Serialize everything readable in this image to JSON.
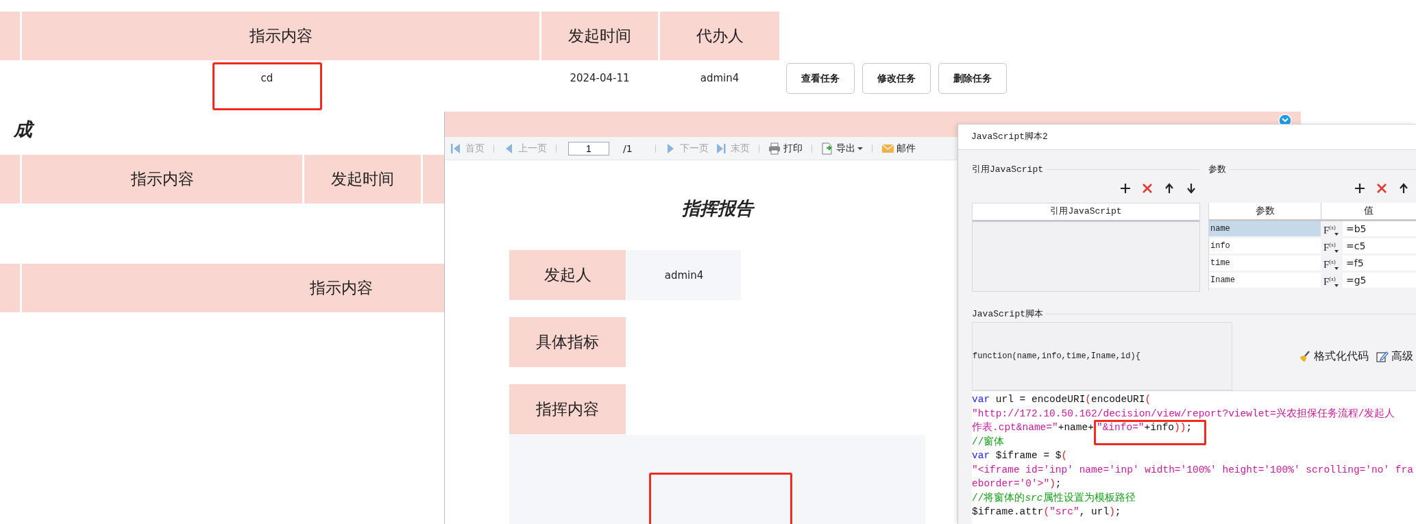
{
  "pending_tasks": {
    "columns": [
      "指示内容",
      "发起时间",
      "代办人"
    ],
    "rows": [
      {
        "cells": [
          {
            "text": "cd",
            "highlighted": true
          },
          {
            "text": "2024-04-11",
            "highlighted": false
          },
          {
            "text": "admin4",
            "highlighted": false
          }
        ],
        "actions": [
          "查看任务",
          "修改任务",
          "删除任务"
        ]
      }
    ]
  },
  "completed_section": {
    "heading": "成",
    "columns": [
      "指示内容",
      "发起时间"
    ]
  },
  "third_table": {
    "columns": [
      "指示内容"
    ]
  },
  "report_viewer": {
    "toolbar": [
      {
        "kind": "first",
        "label": "首页",
        "disabled": true
      },
      {
        "kind": "prev",
        "label": "上一页",
        "disabled": true
      },
      {
        "kind": "page-input",
        "value": "1"
      },
      {
        "kind": "page-total",
        "label": "/1"
      },
      {
        "kind": "next",
        "label": "下一页",
        "disabled": true
      },
      {
        "kind": "last",
        "label": "末页",
        "disabled": true
      },
      {
        "kind": "print",
        "label": "打印",
        "disabled": false
      },
      {
        "kind": "export",
        "label": "导出",
        "disabled": false
      },
      {
        "kind": "mail",
        "label": "邮件",
        "disabled": false
      }
    ],
    "title": "指挥报告",
    "fields": [
      {
        "label": "发起人",
        "value": "admin4"
      },
      {
        "label": "具体指标"
      },
      {
        "label": "指挥内容"
      }
    ],
    "content_area": {
      "highlighted": true
    }
  },
  "js_dialog": {
    "title": "JavaScript脚本2",
    "imported_js": {
      "label": "引用JavaScript",
      "column": "引用JavaScript"
    },
    "params": {
      "label": "参数",
      "columns": [
        "参数",
        "值"
      ],
      "rows": [
        {
          "name": "name",
          "formula": "F$^{(x)}$",
          "value": "=b5",
          "selected": true
        },
        {
          "name": "info",
          "formula": "F$^{(x)}$",
          "value": "=c5",
          "selected": false
        },
        {
          "name": "time",
          "formula": "F$^{(x)}$",
          "value": "=f5",
          "selected": false
        },
        {
          "name": "Iname",
          "formula": "F$^{(x)}$",
          "value": "=g5",
          "selected": false
        }
      ]
    },
    "script": {
      "label": "JavaScript脚本",
      "signature": "function(name,info,time,Iname,id){",
      "actions": [
        {
          "kind": "format",
          "label": "格式化代码"
        },
        {
          "kind": "advanced",
          "label": "高级"
        }
      ],
      "code_lines": [
        {
          "tokens": [
            {
              "kind": "keyword",
              "text": "var"
            },
            {
              "kind": "plain",
              "text": " url = encodeURI"
            },
            {
              "kind": "paren",
              "text": "("
            },
            {
              "kind": "plain",
              "text": "encodeURI"
            },
            {
              "kind": "paren",
              "text": "("
            }
          ]
        },
        {
          "tokens": [
            {
              "kind": "string",
              "text": "\"http://172.10.50.162/decision/view/report?viewlet=兴农担保任务流程/发起人"
            }
          ]
        },
        {
          "tokens": [
            {
              "kind": "string",
              "text": "作表.cpt&name=\""
            },
            {
              "kind": "plain",
              "text": "+name+"
            },
            {
              "kind": "string",
              "text": "\"&info=\"",
              "highlighted": true
            },
            {
              "kind": "plain",
              "text": "+info",
              "highlighted": true
            },
            {
              "kind": "paren",
              "text": "))",
              "highlighted": true
            },
            {
              "kind": "plain",
              "text": ";"
            }
          ]
        },
        {
          "tokens": [
            {
              "kind": "comment",
              "text": "//窗体"
            }
          ]
        },
        {
          "tokens": [
            {
              "kind": "keyword",
              "text": "var"
            },
            {
              "kind": "plain",
              "text": " $iframe = $"
            },
            {
              "kind": "paren",
              "text": "("
            }
          ]
        },
        {
          "tokens": [
            {
              "kind": "string",
              "text": "\"<iframe id='inp' name='inp' width='100%' height='100%' scrolling='no' fra"
            }
          ]
        },
        {
          "tokens": [
            {
              "kind": "string",
              "text": "eborder='0'>\""
            },
            {
              "kind": "paren",
              "text": ")"
            },
            {
              "kind": "plain",
              "text": ";"
            }
          ]
        },
        {
          "tokens": [
            {
              "kind": "comment",
              "text": "//将窗体的"
            },
            {
              "kind": "comment_em",
              "text": "src"
            },
            {
              "kind": "comment",
              "text": "属性设置为模板路径"
            }
          ]
        },
        {
          "tokens": [
            {
              "kind": "plain",
              "text": "$iframe.attr"
            },
            {
              "kind": "paren",
              "text": "("
            },
            {
              "kind": "string",
              "text": "\"src\""
            },
            {
              "kind": "plain",
              "text": ", url"
            },
            {
              "kind": "paren",
              "text": ")"
            },
            {
              "kind": "plain",
              "text": ";"
            }
          ]
        }
      ]
    }
  }
}
